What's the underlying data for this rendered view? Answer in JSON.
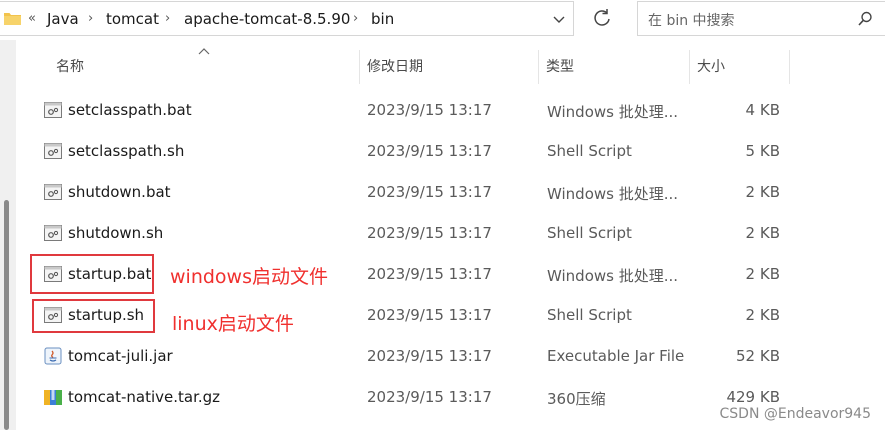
{
  "address_bar": {
    "overflow": "«",
    "breadcrumbs": [
      "Java",
      "tomcat",
      "apache-tomcat-8.5.90",
      "bin"
    ],
    "separator": "›"
  },
  "search": {
    "placeholder": "在 bin 中搜索"
  },
  "columns": {
    "name": "名称",
    "modified": "修改日期",
    "type": "类型",
    "size": "大小"
  },
  "files": [
    {
      "name": "setclasspath.bat",
      "modified": "2023/9/15 13:17",
      "type": "Windows 批处理...",
      "size": "4 KB",
      "icon": "batch-file-icon"
    },
    {
      "name": "setclasspath.sh",
      "modified": "2023/9/15 13:17",
      "type": "Shell Script",
      "size": "5 KB",
      "icon": "script-file-icon"
    },
    {
      "name": "shutdown.bat",
      "modified": "2023/9/15 13:17",
      "type": "Windows 批处理...",
      "size": "2 KB",
      "icon": "batch-file-icon"
    },
    {
      "name": "shutdown.sh",
      "modified": "2023/9/15 13:17",
      "type": "Shell Script",
      "size": "2 KB",
      "icon": "script-file-icon"
    },
    {
      "name": "startup.bat",
      "modified": "2023/9/15 13:17",
      "type": "Windows 批处理...",
      "size": "2 KB",
      "icon": "batch-file-icon"
    },
    {
      "name": "startup.sh",
      "modified": "2023/9/15 13:17",
      "type": "Shell Script",
      "size": "2 KB",
      "icon": "script-file-icon"
    },
    {
      "name": "tomcat-juli.jar",
      "modified": "2023/9/15 13:17",
      "type": "Executable Jar File",
      "size": "52 KB",
      "icon": "jar-file-icon"
    },
    {
      "name": "tomcat-native.tar.gz",
      "modified": "2023/9/15 13:17",
      "type": "360压缩",
      "size": "429 KB",
      "icon": "archive-file-icon"
    }
  ],
  "annotations": {
    "windows": "windows启动文件",
    "linux": "linux启动文件"
  },
  "watermark": "CSDN @Endeavor945",
  "colors": {
    "annotation_red": "#e0393e",
    "annotation_text": "#f0302e"
  }
}
